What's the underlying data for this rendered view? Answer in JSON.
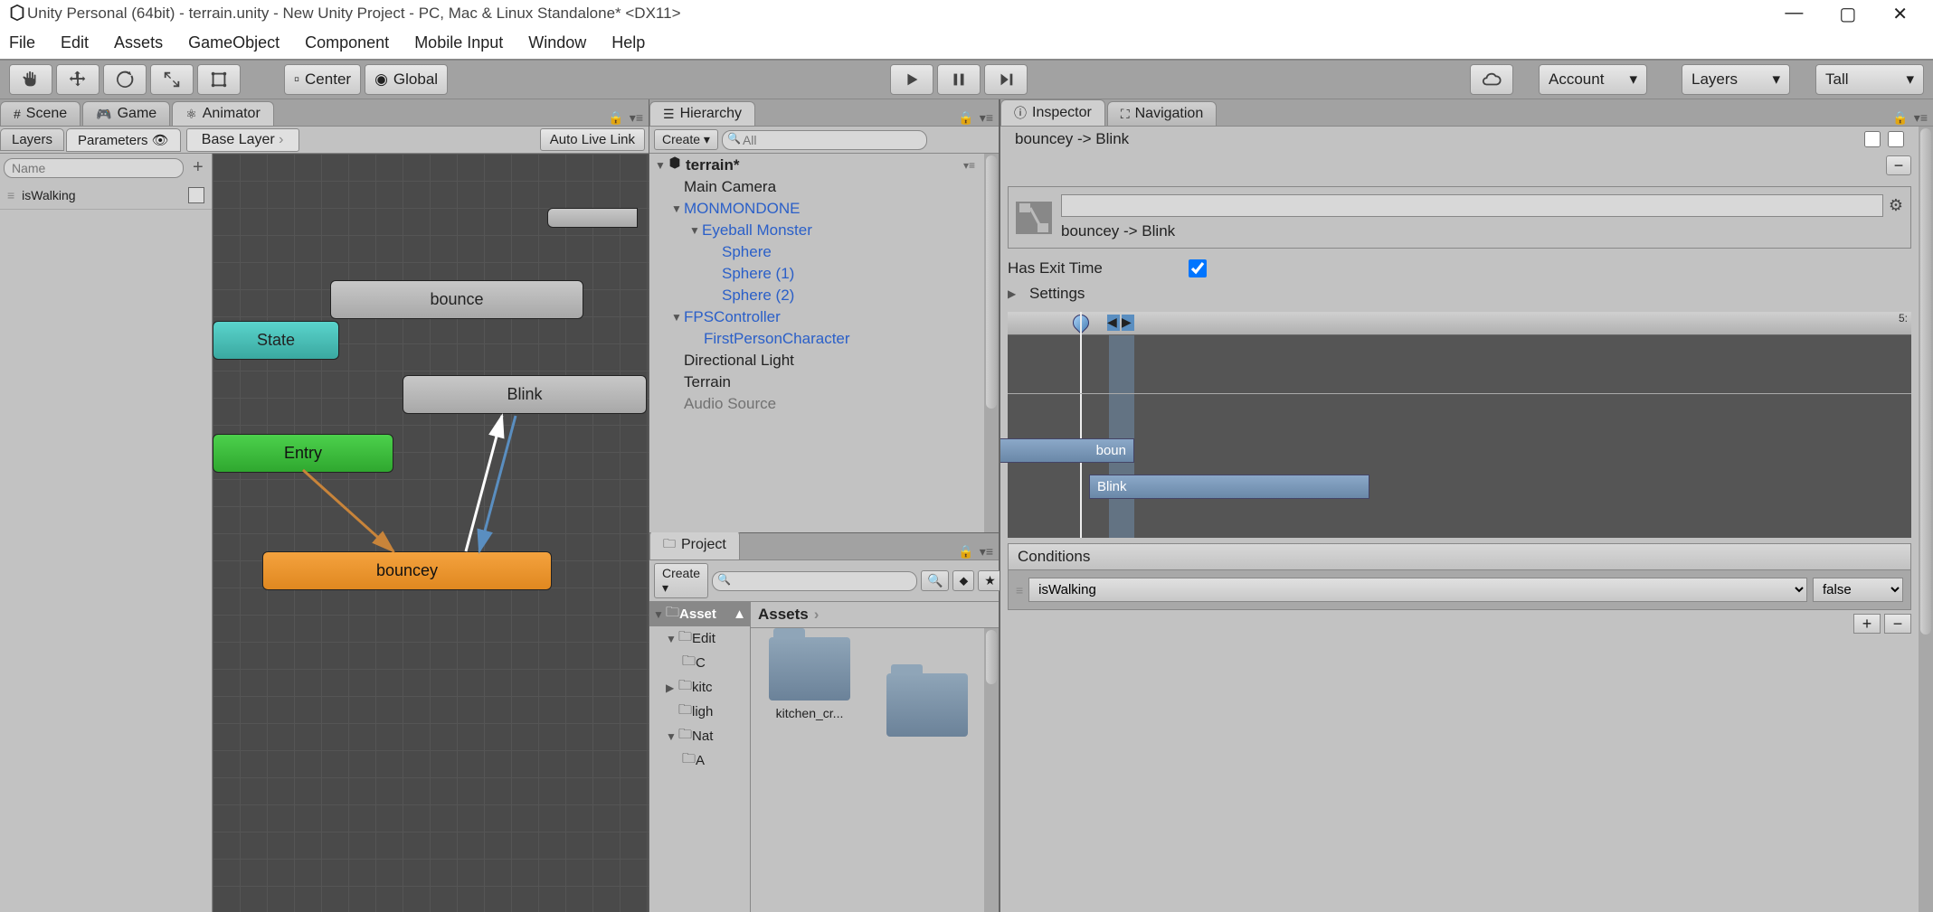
{
  "window": {
    "title": "Unity Personal (64bit) - terrain.unity - New Unity Project - PC, Mac & Linux Standalone* <DX11>"
  },
  "menu": [
    "File",
    "Edit",
    "Assets",
    "GameObject",
    "Component",
    "Mobile Input",
    "Window",
    "Help"
  ],
  "toolbar": {
    "pivot": "Center",
    "coord": "Global",
    "account": "Account",
    "layers": "Layers",
    "layout": "Tall"
  },
  "tabs": {
    "scene": "Scene",
    "game": "Game",
    "animator": "Animator"
  },
  "animator": {
    "layers_tab": "Layers",
    "parameters_tab": "Parameters",
    "base_layer": "Base Layer",
    "auto_live_link": "Auto Live Link",
    "param_search_placeholder": "Name",
    "params": [
      {
        "name": "isWalking",
        "type": "bool"
      }
    ],
    "states": {
      "any_state": "State",
      "bounce": "bounce",
      "blink": "Blink",
      "entry": "Entry",
      "bouncey": "bouncey"
    }
  },
  "hierarchy": {
    "tab": "Hierarchy",
    "create": "Create",
    "search_placeholder": "All",
    "scene": "terrain*",
    "items": [
      {
        "label": "Main Camera",
        "depth": 1,
        "blue": false
      },
      {
        "label": "MONMONDONE",
        "depth": 1,
        "blue": true,
        "arrow": true
      },
      {
        "label": "Eyeball Monster",
        "depth": 2,
        "blue": true,
        "arrow": true
      },
      {
        "label": "Sphere",
        "depth": 3,
        "blue": true
      },
      {
        "label": "Sphere (1)",
        "depth": 3,
        "blue": true
      },
      {
        "label": "Sphere (2)",
        "depth": 3,
        "blue": true
      },
      {
        "label": "FPSController",
        "depth": 1,
        "blue": true,
        "arrow": true
      },
      {
        "label": "FirstPersonCharacter",
        "depth": 2,
        "blue": true
      },
      {
        "label": "Directional Light",
        "depth": 1,
        "blue": false
      },
      {
        "label": "Terrain",
        "depth": 1,
        "blue": false
      },
      {
        "label": "Audio Source",
        "depth": 1,
        "blue": false
      }
    ]
  },
  "project": {
    "tab": "Project",
    "create": "Create",
    "root": "Asset",
    "folders": [
      "Edit",
      "C",
      "kitc",
      "ligh",
      "Nat",
      "A"
    ],
    "breadcrumb": "Assets",
    "items": [
      {
        "name": "kitchen_cr..."
      }
    ]
  },
  "inspector": {
    "tab": "Inspector",
    "nav_tab": "Navigation",
    "transition_list_item": "bouncey -> Blink",
    "transition_name": "bouncey -> Blink",
    "has_exit_time": "Has Exit Time",
    "settings": "Settings",
    "timeline_end": "5:",
    "clip_a": "boun",
    "clip_b": "Blink",
    "conditions": "Conditions",
    "cond_param": "isWalking",
    "cond_value": "false"
  }
}
